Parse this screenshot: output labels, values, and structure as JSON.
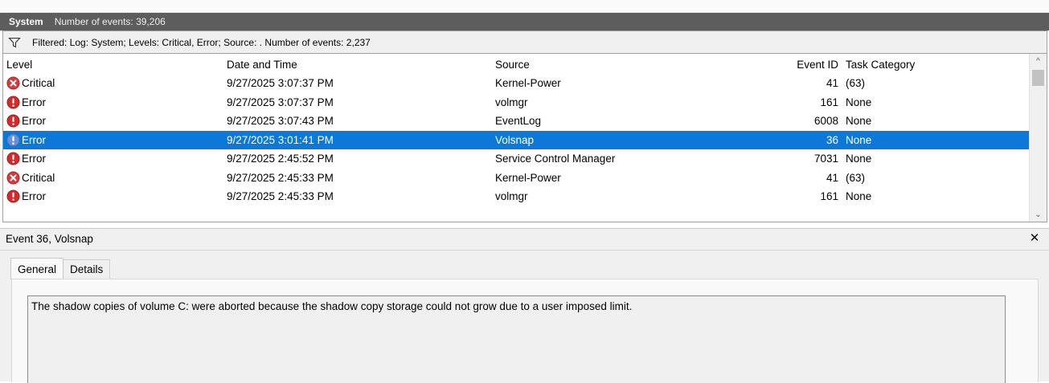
{
  "header": {
    "title": "System",
    "event_count": "Number of events: 39,206"
  },
  "filter": {
    "icon": "funnel-icon",
    "text": "Filtered: Log: System; Levels: Critical, Error; Source: . Number of events: 2,237"
  },
  "columns": {
    "level": "Level",
    "date": "Date and Time",
    "source": "Source",
    "event_id": "Event ID",
    "task": "Task Category"
  },
  "rows": [
    {
      "level": "Critical",
      "icon": "critical-icon",
      "date": "9/27/2025 3:07:37 PM",
      "source": "Kernel-Power",
      "event_id": "41",
      "task": "(63)"
    },
    {
      "level": "Error",
      "icon": "error-icon",
      "date": "9/27/2025 3:07:37 PM",
      "source": "volmgr",
      "event_id": "161",
      "task": "None"
    },
    {
      "level": "Error",
      "icon": "error-icon",
      "date": "9/27/2025 3:07:43 PM",
      "source": "EventLog",
      "event_id": "6008",
      "task": "None"
    },
    {
      "level": "Error",
      "icon": "error-icon",
      "date": "9/27/2025 3:01:41 PM",
      "source": "Volsnap",
      "event_id": "36",
      "task": "None",
      "selected": true
    },
    {
      "level": "Error",
      "icon": "error-icon",
      "date": "9/27/2025 2:45:52 PM",
      "source": "Service Control Manager",
      "event_id": "7031",
      "task": "None"
    },
    {
      "level": "Critical",
      "icon": "critical-icon",
      "date": "9/27/2025 2:45:33 PM",
      "source": "Kernel-Power",
      "event_id": "41",
      "task": "(63)"
    },
    {
      "level": "Error",
      "icon": "error-icon",
      "date": "9/27/2025 2:45:33 PM",
      "source": "volmgr",
      "event_id": "161",
      "task": "None"
    }
  ],
  "detail": {
    "title": "Event 36, Volsnap",
    "close_icon": "close-icon",
    "tabs": [
      "General",
      "Details"
    ],
    "active_tab": "General",
    "message": "The shadow copies of volume C: were aborted because the shadow copy storage could not grow due to a user imposed limit."
  },
  "colors": {
    "header_bg": "#5d5d5d",
    "selection": "#0c79d9",
    "critical": "#d83b3b",
    "error": "#d42a2a"
  }
}
